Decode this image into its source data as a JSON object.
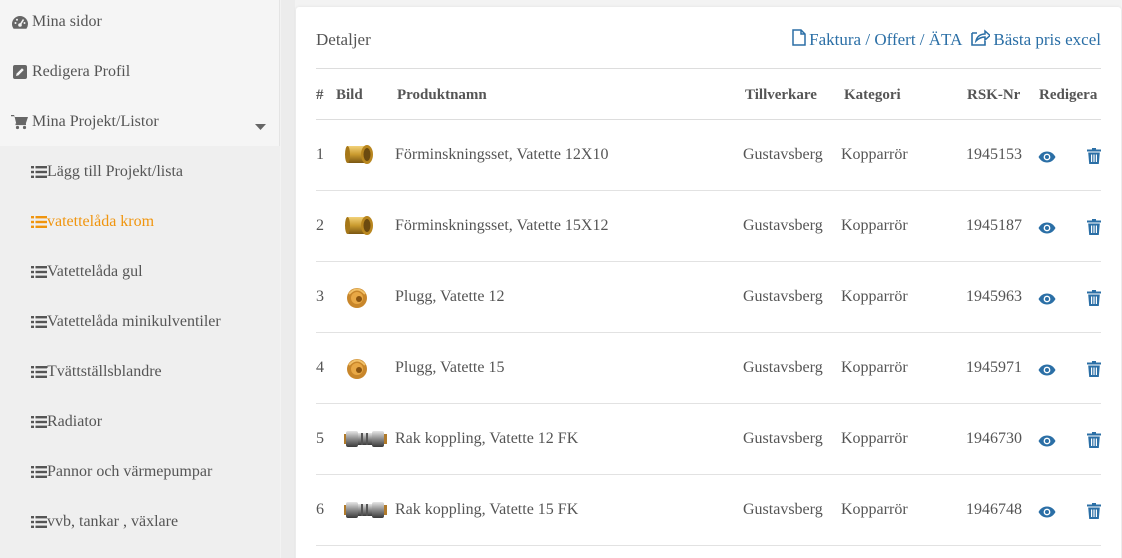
{
  "sidebar": {
    "items": [
      {
        "label": "Mina sidor",
        "icon": "dashboard-icon"
      },
      {
        "label": "Redigera Profil",
        "icon": "edit-icon"
      },
      {
        "label": "Mina Projekt/Listor",
        "icon": "cart-icon"
      }
    ],
    "sub_items": [
      {
        "label": "Lägg till Projekt/lista",
        "active": false
      },
      {
        "label": "vatettelåda krom",
        "active": true
      },
      {
        "label": "Vatettelåda gul",
        "active": false
      },
      {
        "label": "Vatettelåda minikulventiler",
        "active": false
      },
      {
        "label": "Tvättställsblandre",
        "active": false
      },
      {
        "label": "Radiator",
        "active": false
      },
      {
        "label": "Pannor och värmepumpar",
        "active": false
      },
      {
        "label": "vvb, tankar , växlare",
        "active": false
      }
    ]
  },
  "panel": {
    "title": "Detaljer",
    "link_invoice": "Faktura / Offert / ÄTA",
    "link_excel": "Bästa pris excel"
  },
  "table": {
    "headers": [
      "#",
      "Bild",
      "Produktnamn",
      "Tillverkare",
      "Kategori",
      "RSK-Nr",
      "Redigera"
    ],
    "rows": [
      {
        "num": "1",
        "name": "Förminskningsset, Vatette 12X10",
        "maker": "Gustavsberg",
        "category": "Kopparrör",
        "rsk": "1945153",
        "img": "reducer"
      },
      {
        "num": "2",
        "name": "Förminskningsset, Vatette 15X12",
        "maker": "Gustavsberg",
        "category": "Kopparrör",
        "rsk": "1945187",
        "img": "reducer"
      },
      {
        "num": "3",
        "name": "Plugg, Vatette 12",
        "maker": "Gustavsberg",
        "category": "Kopparrör",
        "rsk": "1945963",
        "img": "plug"
      },
      {
        "num": "4",
        "name": "Plugg, Vatette 15",
        "maker": "Gustavsberg",
        "category": "Kopparrör",
        "rsk": "1945971",
        "img": "plug"
      },
      {
        "num": "5",
        "name": "Rak koppling, Vatette 12 FK",
        "maker": "Gustavsberg",
        "category": "Kopparrör",
        "rsk": "1946730",
        "img": "coupling"
      },
      {
        "num": "6",
        "name": "Rak koppling, Vatette 15 FK",
        "maker": "Gustavsberg",
        "category": "Kopparrör",
        "rsk": "1946748",
        "img": "coupling"
      }
    ]
  },
  "colors": {
    "accent": "#f0950e",
    "link": "#2b6fa6"
  }
}
